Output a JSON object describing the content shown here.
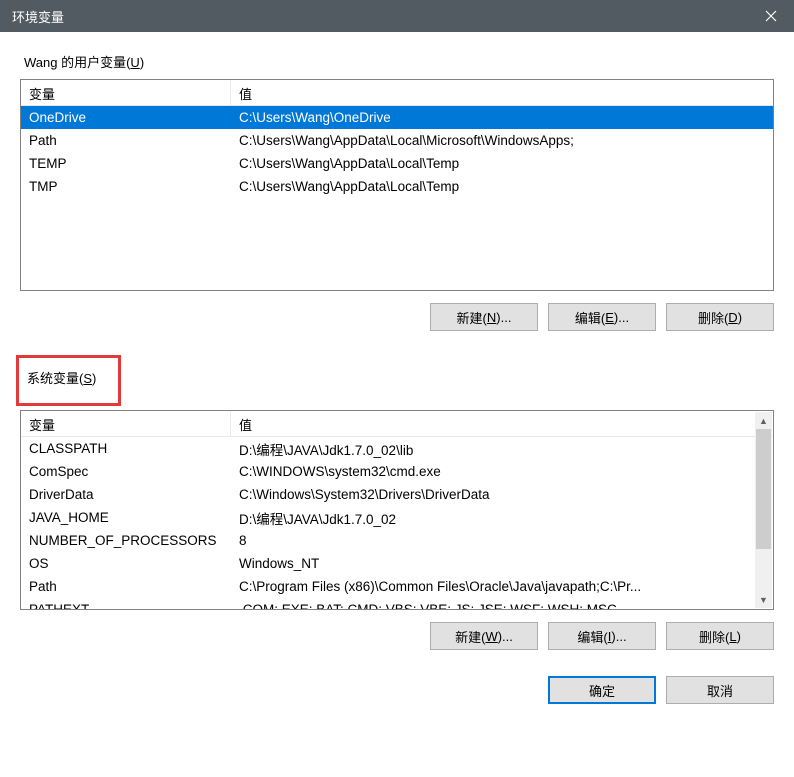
{
  "titlebar": {
    "title": "环境变量"
  },
  "user": {
    "label_pre": "Wang 的用户变量(",
    "label_u": "U",
    "label_post": ")",
    "col_var": "变量",
    "col_val": "值",
    "rows": [
      {
        "name": "OneDrive",
        "value": "C:\\Users\\Wang\\OneDrive",
        "selected": true
      },
      {
        "name": "Path",
        "value": "C:\\Users\\Wang\\AppData\\Local\\Microsoft\\WindowsApps;",
        "selected": false
      },
      {
        "name": "TEMP",
        "value": "C:\\Users\\Wang\\AppData\\Local\\Temp",
        "selected": false
      },
      {
        "name": "TMP",
        "value": "C:\\Users\\Wang\\AppData\\Local\\Temp",
        "selected": false
      }
    ],
    "btn_new_pre": "新建(",
    "btn_new_u": "N",
    "btn_new_post": ")...",
    "btn_edit_pre": "编辑(",
    "btn_edit_u": "E",
    "btn_edit_post": ")...",
    "btn_del_pre": "删除(",
    "btn_del_u": "D",
    "btn_del_post": ")"
  },
  "system": {
    "label_pre": "系统变量(",
    "label_u": "S",
    "label_post": ")",
    "col_var": "变量",
    "col_val": "值",
    "rows": [
      {
        "name": "CLASSPATH",
        "value": "D:\\编程\\JAVA\\Jdk1.7.0_02\\lib"
      },
      {
        "name": "ComSpec",
        "value": "C:\\WINDOWS\\system32\\cmd.exe"
      },
      {
        "name": "DriverData",
        "value": "C:\\Windows\\System32\\Drivers\\DriverData"
      },
      {
        "name": "JAVA_HOME",
        "value": "D:\\编程\\JAVA\\Jdk1.7.0_02"
      },
      {
        "name": "NUMBER_OF_PROCESSORS",
        "value": "8"
      },
      {
        "name": "OS",
        "value": "Windows_NT"
      },
      {
        "name": "Path",
        "value": "C:\\Program Files (x86)\\Common Files\\Oracle\\Java\\javapath;C:\\Pr..."
      },
      {
        "name": "PATHEXT",
        "value": ".COM;.EXE;.BAT;.CMD;.VBS;.VBE;.JS;.JSE;.WSF;.WSH;.MSC"
      }
    ],
    "btn_new_pre": "新建(",
    "btn_new_u": "W",
    "btn_new_post": ")...",
    "btn_edit_pre": "编辑(",
    "btn_edit_u": "I",
    "btn_edit_post": ")...",
    "btn_del_pre": "删除(",
    "btn_del_u": "L",
    "btn_del_post": ")"
  },
  "dialog": {
    "ok": "确定",
    "cancel": "取消"
  }
}
